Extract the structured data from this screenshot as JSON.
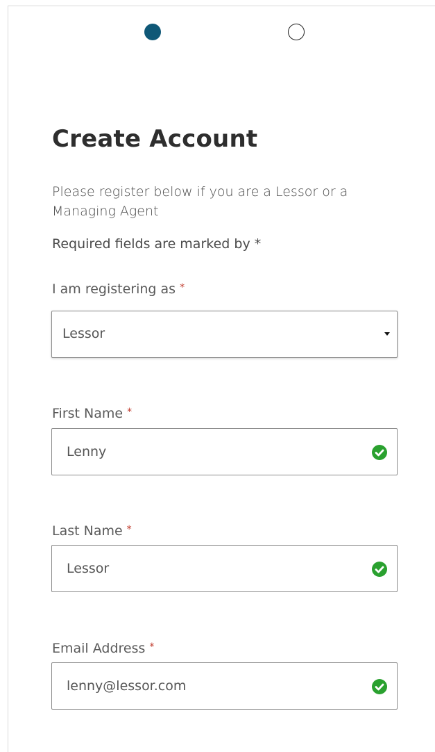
{
  "steps": [
    {
      "state": "active",
      "color": "#0f5877"
    },
    {
      "state": "inactive"
    }
  ],
  "title": "Create Account",
  "intro": "Please register below if you are a Lessor or a Managing Agent",
  "required_note": "Required fields are marked by *",
  "fields": {
    "registering_as": {
      "label": "I am registering as",
      "required_mark": "*",
      "value": "Lessor"
    },
    "first_name": {
      "label": "First Name",
      "required_mark": "*",
      "value": "Lenny",
      "valid": true
    },
    "last_name": {
      "label": "Last Name",
      "required_mark": "*",
      "value": "Lessor",
      "valid": true
    },
    "email": {
      "label": "Email Address",
      "required_mark": "*",
      "value": "lenny@lessor.com",
      "valid": true
    }
  },
  "icons": {
    "valid": "check-circle-icon",
    "select": "caret-down-icon"
  },
  "colors": {
    "accent": "#0f5877",
    "valid": "#2aa12f",
    "required": "#c0392b"
  }
}
